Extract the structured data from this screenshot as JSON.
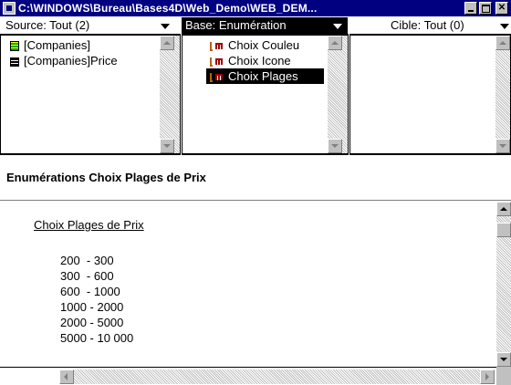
{
  "window": {
    "title": "C:\\WINDOWS\\Bureau\\Bases4D\\Web_Demo\\WEB_DEM...",
    "title_bar_color": "#000080",
    "buttons": [
      "minimize",
      "maximize",
      "close"
    ]
  },
  "columns": {
    "source": {
      "label": "Source: Tout (2)",
      "items": [
        {
          "label": "[Companies]",
          "icon": "table-icon"
        },
        {
          "label": "[Companies]Price",
          "icon": "list-icon"
        }
      ]
    },
    "base": {
      "label": "Base: Enumération",
      "items": [
        {
          "label": "Choix Couleu",
          "icon": "enumeration-icon"
        },
        {
          "label": "Choix Icone",
          "icon": "enumeration-icon"
        },
        {
          "label": "Choix Plages",
          "icon": "enumeration-icon",
          "selected": true
        }
      ]
    },
    "cible": {
      "label": "Cible: Tout (0)",
      "items": []
    }
  },
  "detail": {
    "heading": "Enumérations Choix Plages de Prix",
    "list_title": "Choix Plages de Prix",
    "ranges": [
      "200  - 300",
      "300  - 600",
      "600  - 1000",
      "1000 - 2000",
      "2000 - 5000",
      "5000 - 10 000"
    ]
  }
}
